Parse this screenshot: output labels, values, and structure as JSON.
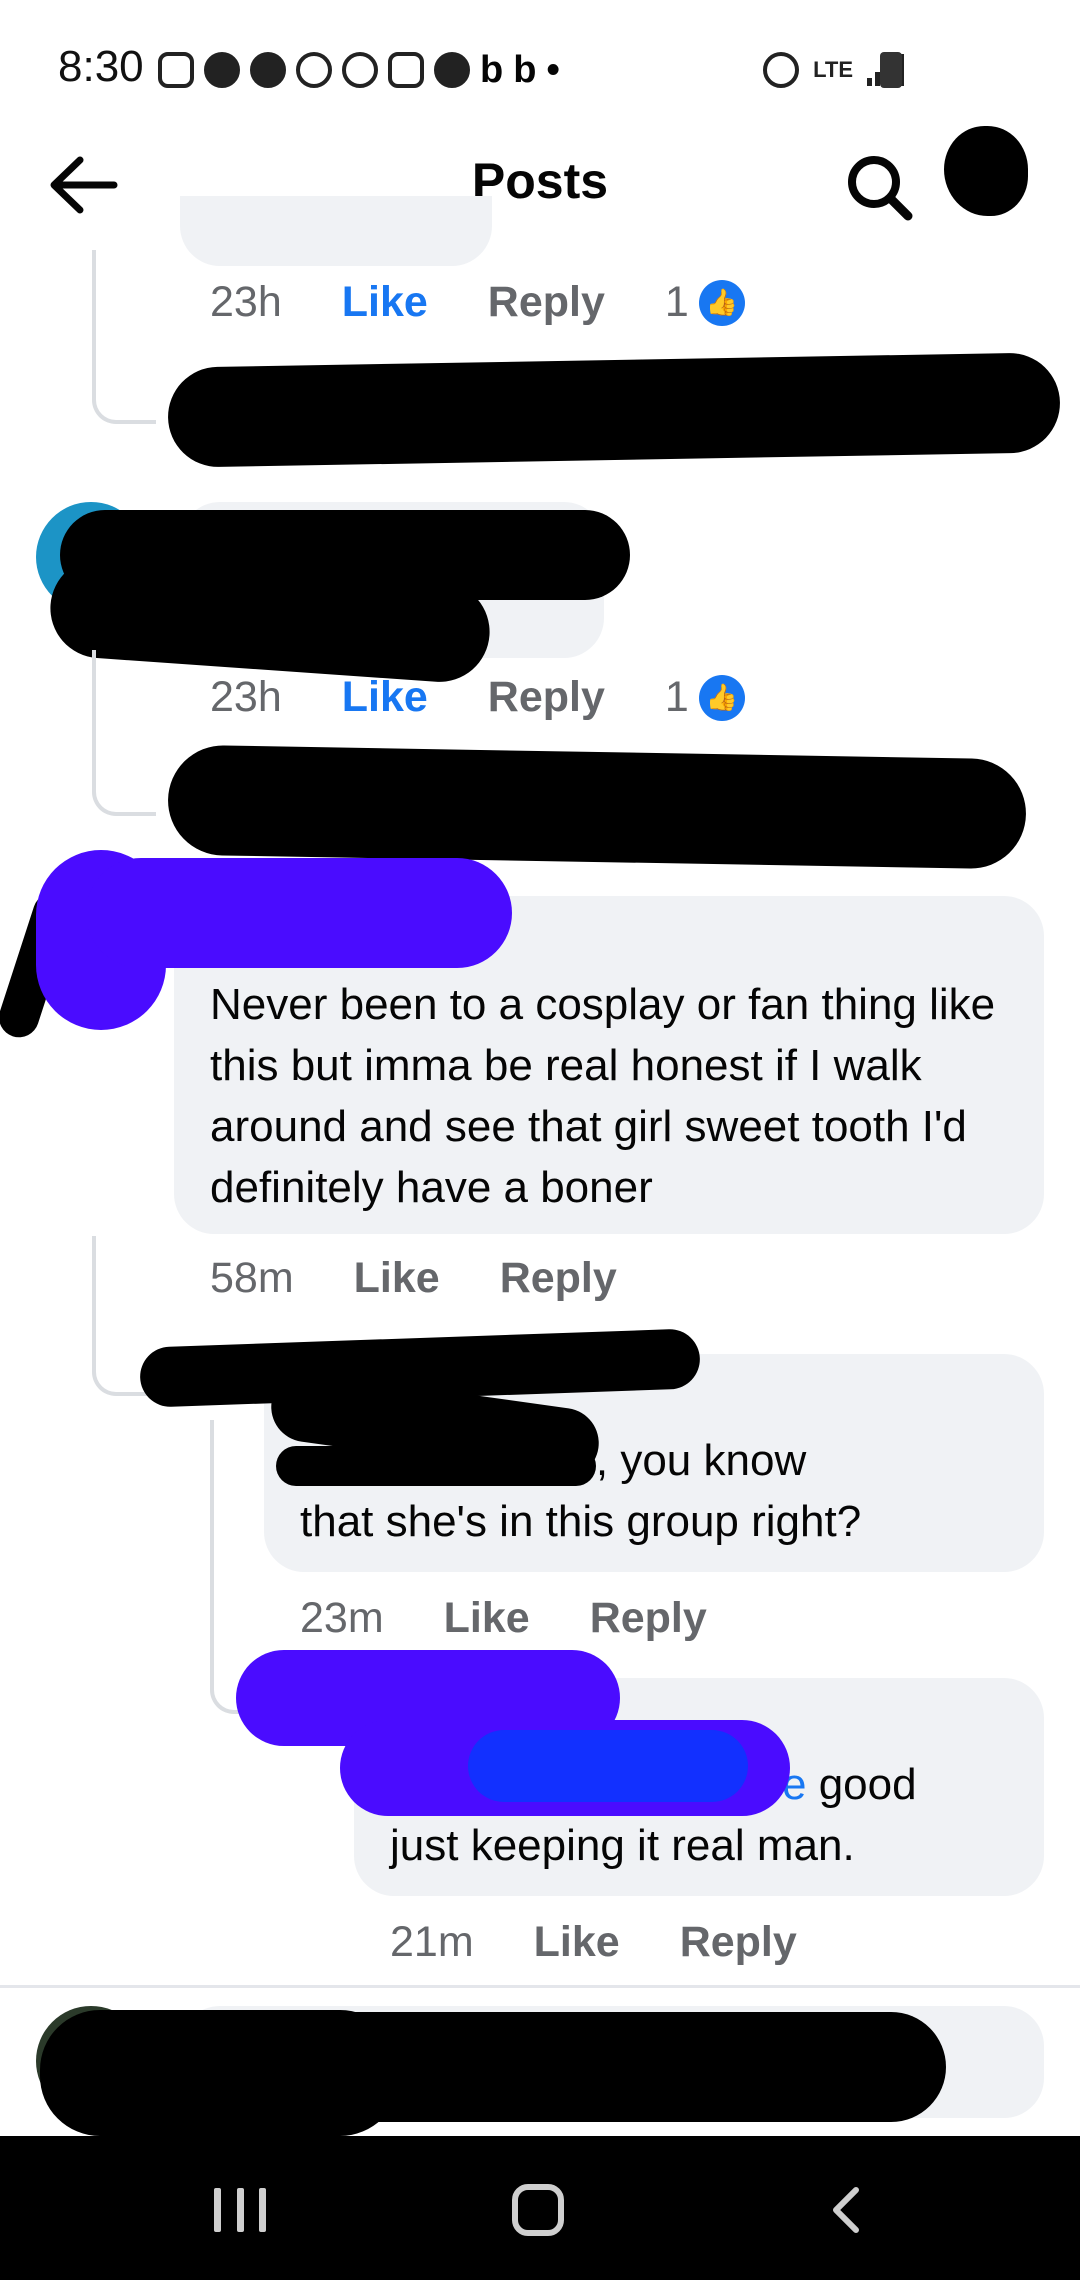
{
  "status_bar": {
    "time": "8:30",
    "network": "LTE"
  },
  "header": {
    "title": "Posts"
  },
  "comments": [
    {
      "time": "23h",
      "like_label": "Like",
      "reply_label": "Reply",
      "reactions": "1"
    },
    {
      "time": "23h",
      "like_label": "Like",
      "reply_label": "Reply",
      "reactions": "1"
    },
    {
      "text": "Never been to a cosplay or fan thing like this but imma be real honest if I walk around and see that girl sweet tooth I'd definitely have a boner",
      "time": "58m",
      "like_label": "Like",
      "reply_label": "Reply"
    }
  ],
  "replies": [
    {
      "text_line1": "dude, you know",
      "text_line2": "that she's in this group right?",
      "time": "23m",
      "like_label": "Like",
      "reply_label": "Reply"
    },
    {
      "mention_tail": "e",
      "text_line1": " good",
      "text_line2": "just keeping it real man.",
      "time": "21m",
      "like_label": "Like",
      "reply_label": "Reply"
    }
  ],
  "colors": {
    "accent": "#1877f2",
    "meta": "#65676b",
    "bubble": "#f0f2f5"
  }
}
